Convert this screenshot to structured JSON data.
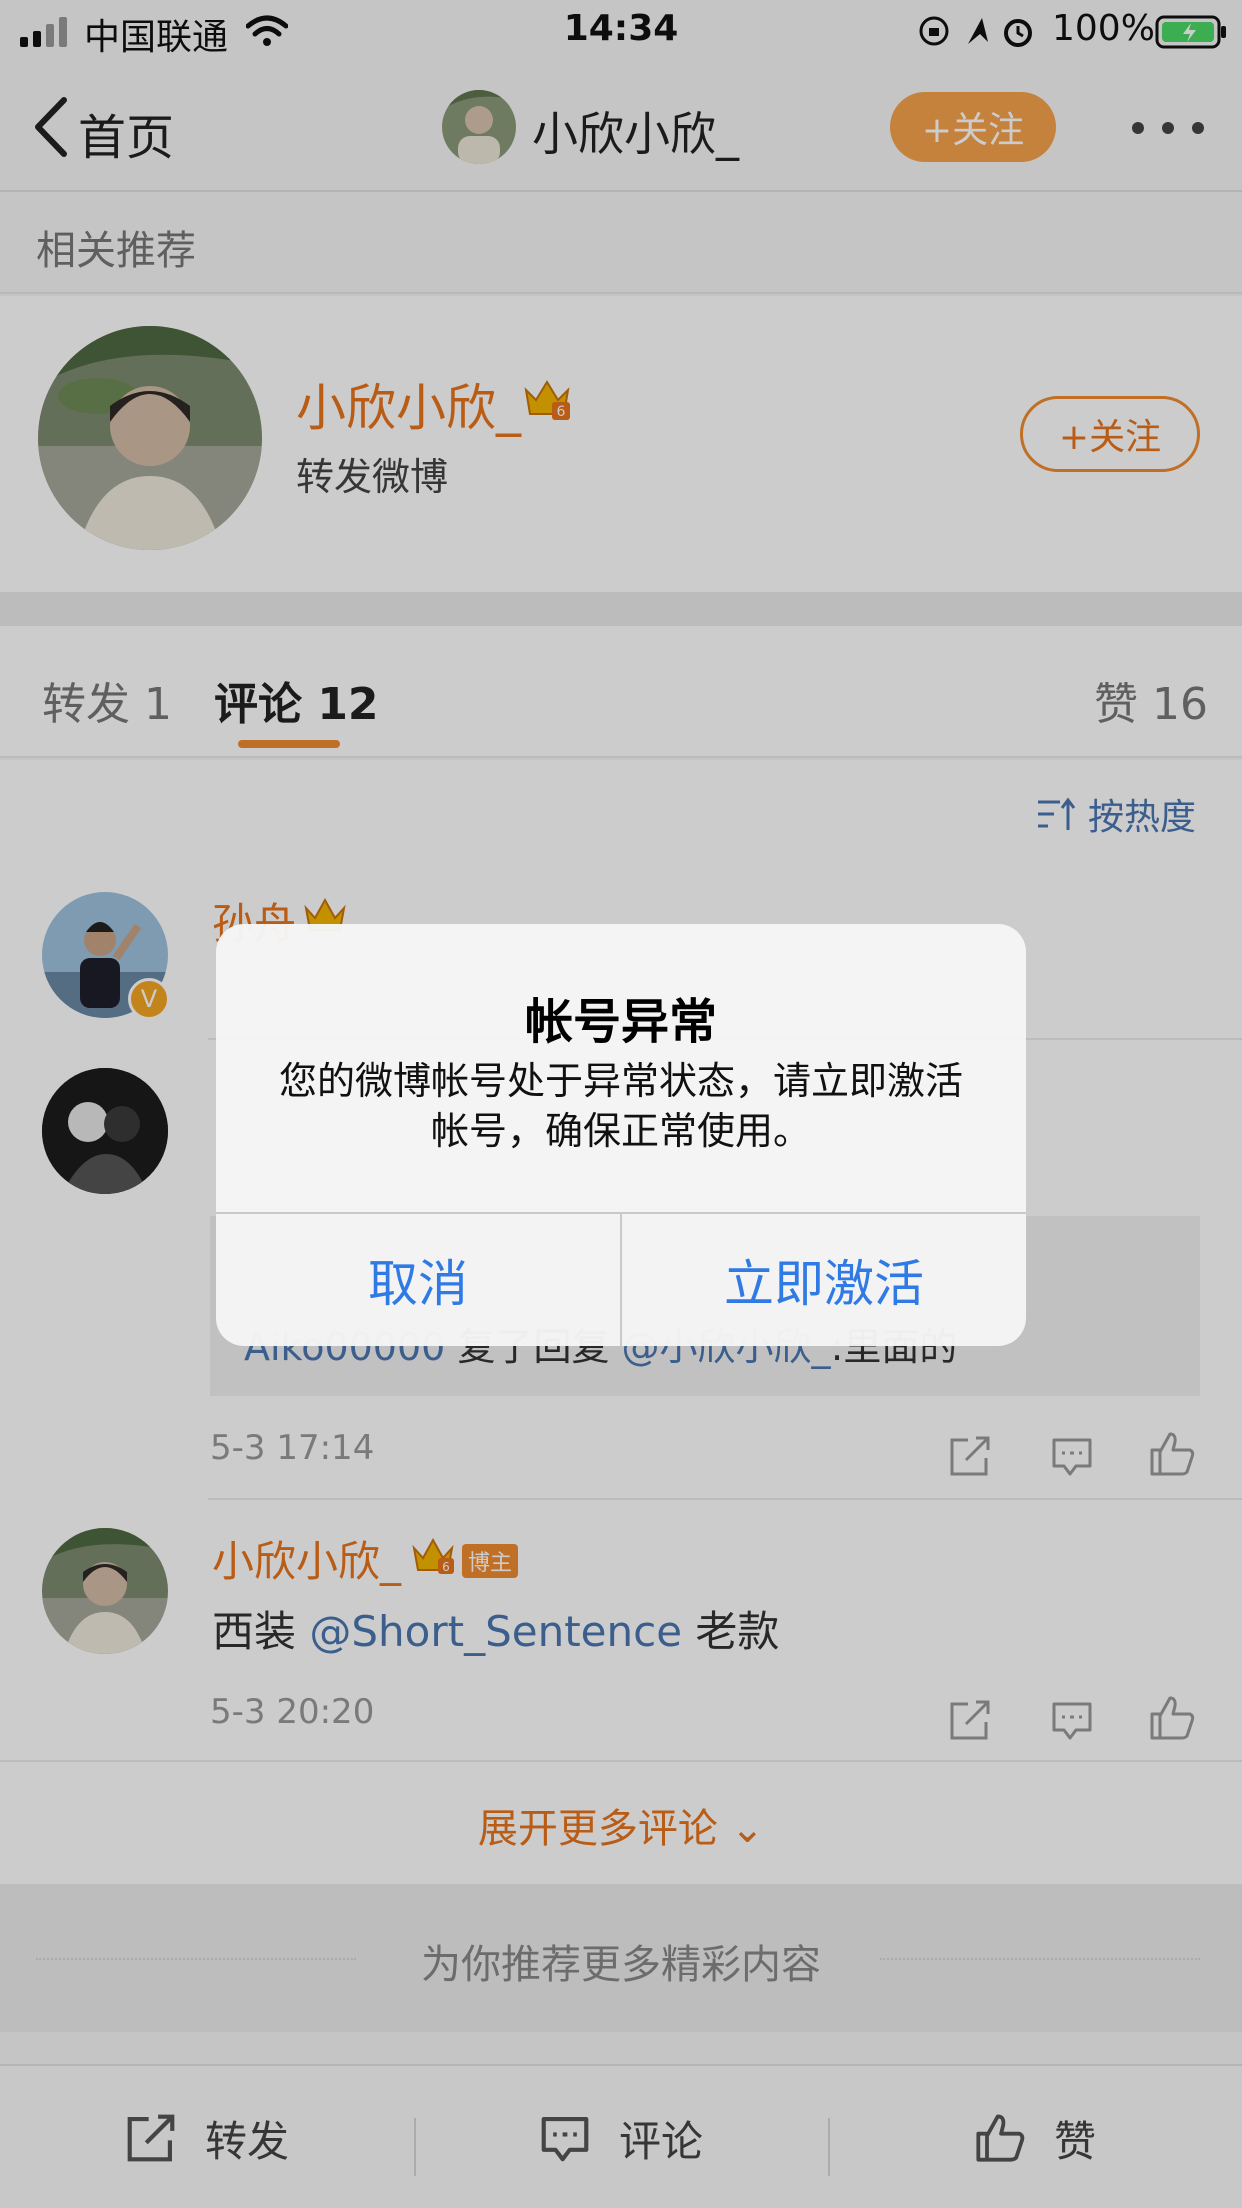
{
  "status_bar": {
    "carrier": "中国联通",
    "time": "14:34",
    "battery": "100%"
  },
  "nav": {
    "back_label": "首页",
    "title": "小欣小欣_",
    "follow_label": "+关注"
  },
  "recommend": {
    "header": "相关推荐",
    "name": "小欣小欣_",
    "desc": "转发微博",
    "follow_label": "+关注"
  },
  "tabs": {
    "repost": "转发 1",
    "comment": "评论 12",
    "like": "赞 16"
  },
  "sort_label": "按热度",
  "comments": [
    {
      "name": "孙舟",
      "badge": "V",
      "text": ""
    },
    {
      "name": "",
      "text": "",
      "reply": {
        "user": "Aiko00000",
        "verb": "复了回复",
        "mention": "@小欣小欣_",
        "text": ":里面的"
      },
      "time": "5-3 17:14"
    },
    {
      "name": "小欣小欣_",
      "tag": "博主",
      "text_pre": "西装 ",
      "mention": "@Short_Sentence",
      "text_post": " 老款",
      "time": "5-3 20:20"
    }
  ],
  "expand_more": "展开更多评论",
  "recommend_more": "为你推荐更多精彩内容",
  "toolbar": {
    "repost": "转发",
    "comment": "评论",
    "like": "赞"
  },
  "dialog": {
    "title": "帐号异常",
    "message": "您的微博帐号处于异常状态，请立即激活帐号，确保正常使用。",
    "cancel": "取消",
    "confirm": "立即激活"
  },
  "colors": {
    "accent_orange": "#e8731c",
    "link_blue": "#4a76b0",
    "dialog_button_blue": "#2f7ae5"
  }
}
